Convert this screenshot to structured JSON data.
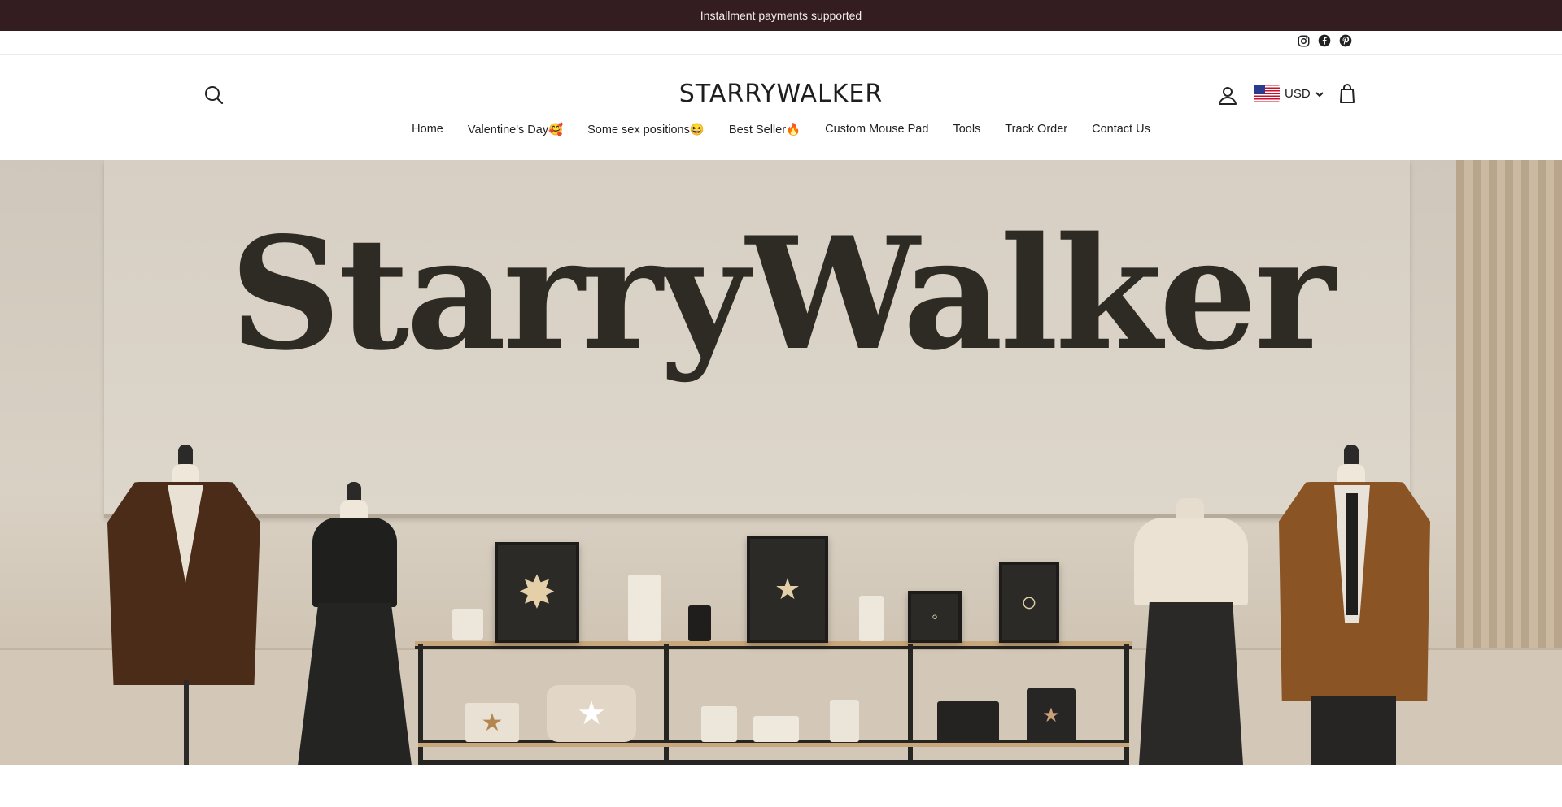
{
  "announcement": {
    "text": "Installment payments supported"
  },
  "social": {
    "icons": [
      "instagram-icon",
      "facebook-icon",
      "pinterest-icon"
    ]
  },
  "header": {
    "logo": "STARRYWALKER",
    "currency": {
      "code": "USD",
      "flag": "us-flag-icon"
    }
  },
  "nav": {
    "items": [
      {
        "label": "Home"
      },
      {
        "label": "Valentine's Day🥰"
      },
      {
        "label": "Some sex positions😆"
      },
      {
        "label": "Best Seller🔥"
      },
      {
        "label": "Custom Mouse Pad"
      },
      {
        "label": "Tools"
      },
      {
        "label": "Track Order"
      },
      {
        "label": "Contact Us"
      }
    ]
  },
  "hero": {
    "title": "StarryWalker"
  },
  "colors": {
    "announcement_bg": "#331d20",
    "announcement_text": "#f3ecec",
    "hero_text": "#2e2b24"
  }
}
